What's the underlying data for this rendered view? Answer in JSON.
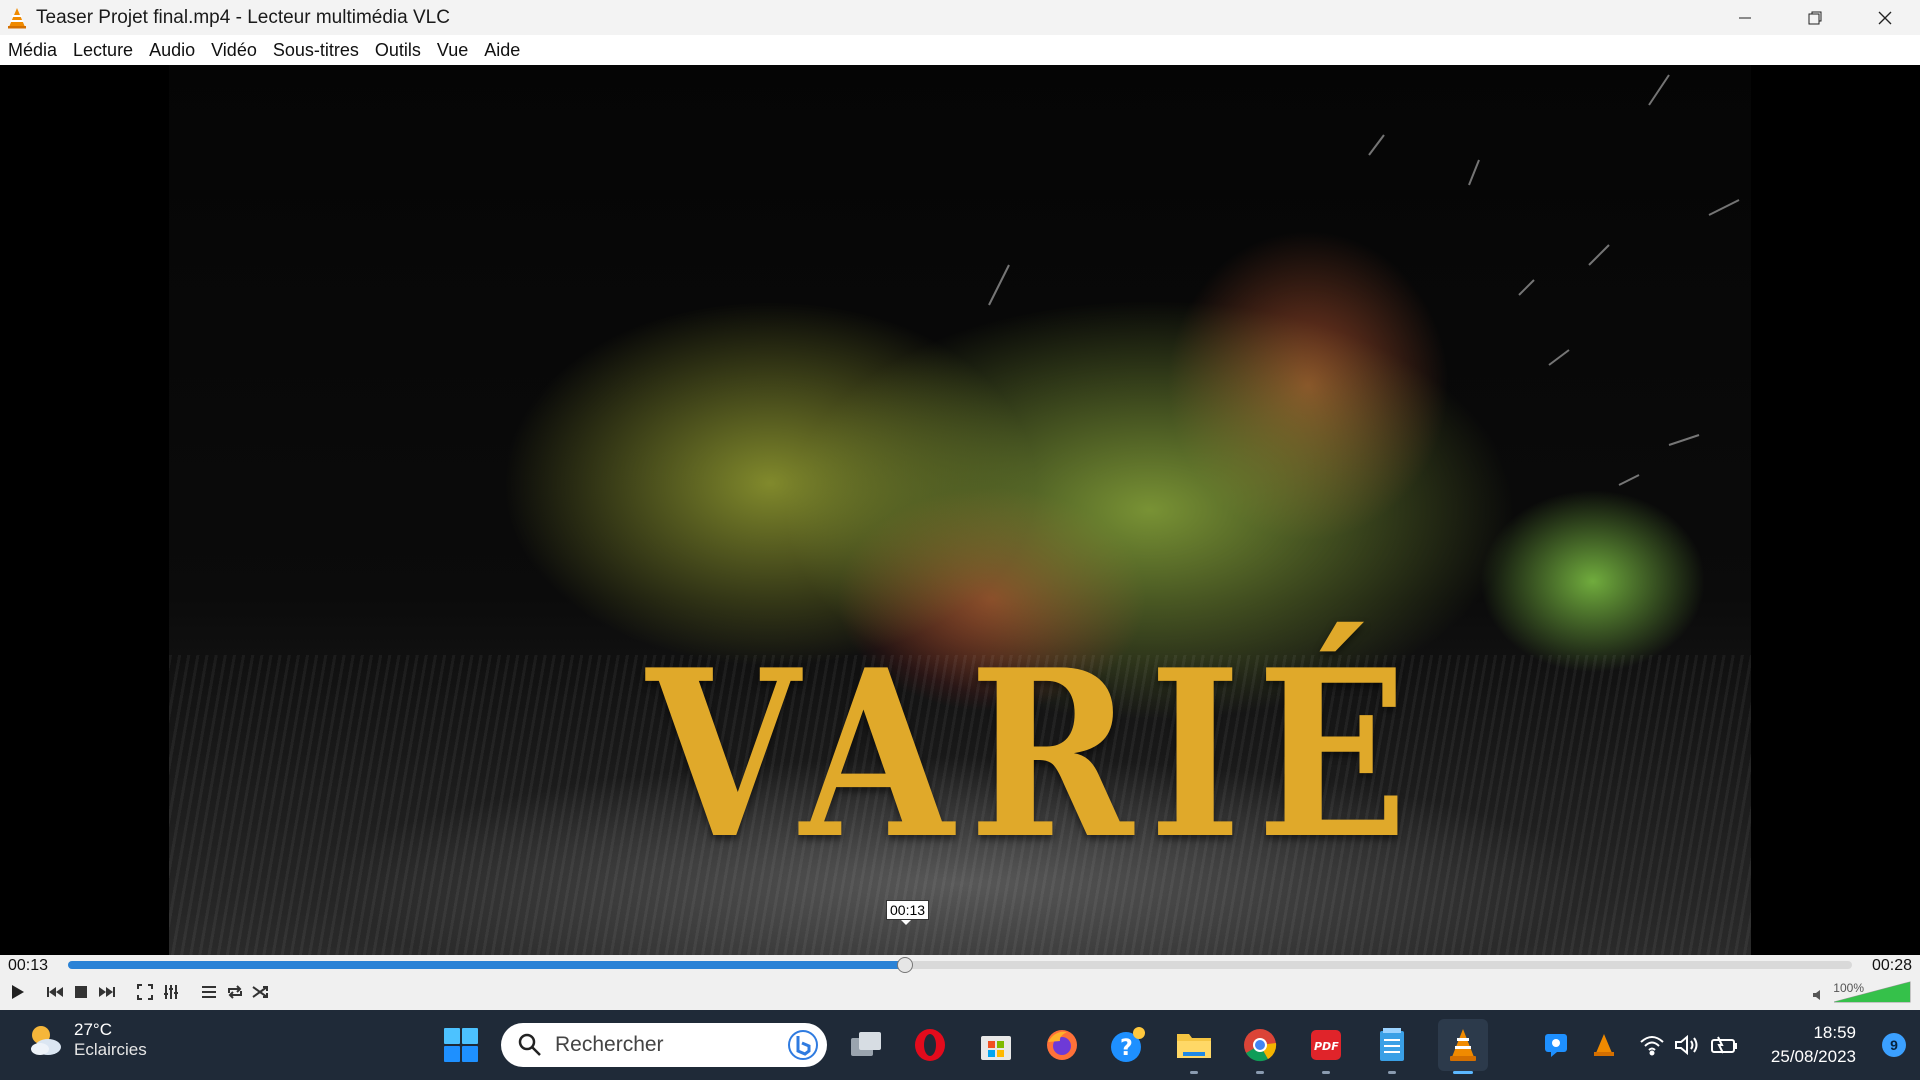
{
  "window": {
    "title": "Teaser Projet final.mp4 - Lecteur multimédia VLC",
    "controls": [
      "minimize-icon",
      "restore-icon",
      "close-icon"
    ]
  },
  "menu": {
    "items": [
      "Média",
      "Lecture",
      "Audio",
      "Vidéo",
      "Sous-titres",
      "Outils",
      "Vue",
      "Aide"
    ]
  },
  "video": {
    "overlay_text": "VARIÉ",
    "seek_tooltip": "00:13"
  },
  "player": {
    "elapsed": "00:13",
    "duration": "00:28",
    "progress": 0.469,
    "volume_label": "100%",
    "volume_level": 1.0,
    "accent_color": "#2a82d6"
  },
  "taskbar": {
    "weather_temp": "27°C",
    "weather_desc": "Eclaircies",
    "search_placeholder": "Rechercher",
    "clock_time": "18:59",
    "clock_date": "25/08/2023",
    "notification_count": "9",
    "background": "#1f2a38"
  }
}
